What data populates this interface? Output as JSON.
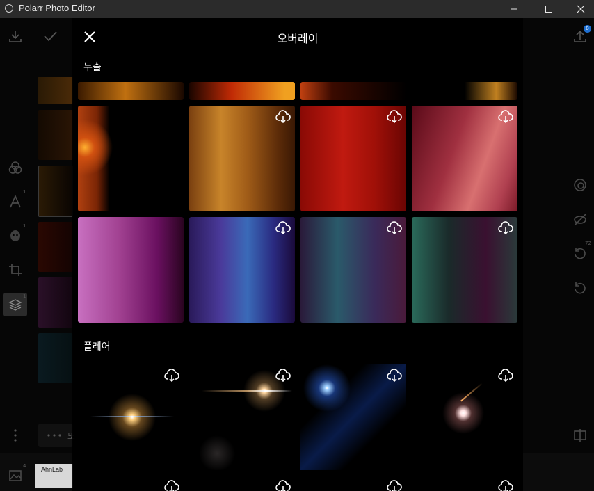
{
  "window": {
    "title": "Polarr Photo Editor"
  },
  "overlay_panel": {
    "title": "오버레이",
    "sections": [
      {
        "label": "누출"
      },
      {
        "label": "플레어"
      }
    ]
  },
  "right_toolbar": {
    "badge_count": "72"
  },
  "left_toolbar": {
    "text_badge": "1",
    "face_badge": "1",
    "layers_badge": "1"
  },
  "bottom": {
    "partial_label": "또",
    "ahnlab_label": "AhnLab",
    "image_badge": "4"
  },
  "top_toolbar": {
    "upload_badge": "0"
  },
  "colors": {
    "titlebar_bg": "#2b2b2b",
    "background": "#000000",
    "icon_gray": "#9a9a9a"
  }
}
